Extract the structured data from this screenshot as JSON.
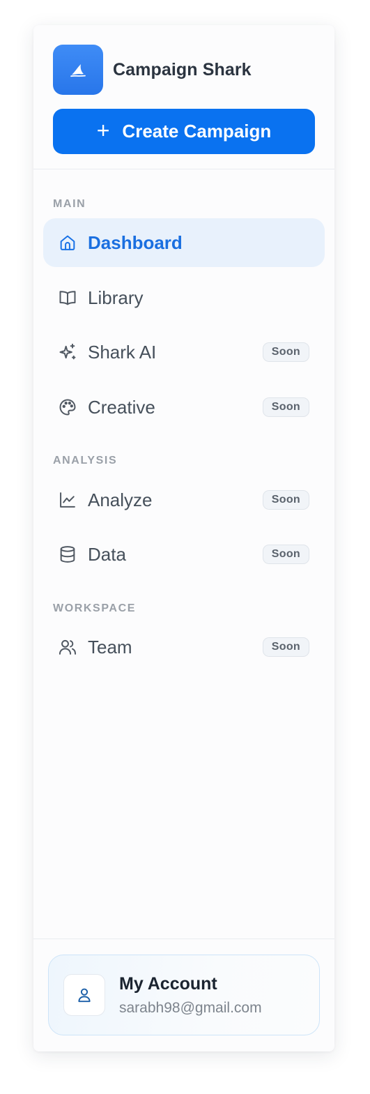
{
  "brand": {
    "name": "Campaign Shark",
    "logo_icon": "shark-fin-icon",
    "logo_color": "#2f7ff0"
  },
  "create_button": {
    "label": "Create Campaign",
    "icon": "plus-icon",
    "color": "#0a72f0"
  },
  "sections": [
    {
      "title": "MAIN"
    },
    {
      "title": "ANALYSIS"
    },
    {
      "title": "WORKSPACE"
    }
  ],
  "nav": {
    "dashboard": {
      "label": "Dashboard",
      "icon": "home-icon",
      "active": true
    },
    "library": {
      "label": "Library",
      "icon": "book-open-icon"
    },
    "shark_ai": {
      "label": "Shark AI",
      "icon": "sparkles-icon",
      "badge": "Soon"
    },
    "creative": {
      "label": "Creative",
      "icon": "palette-icon",
      "badge": "Soon"
    },
    "analyze": {
      "label": "Analyze",
      "icon": "line-chart-icon",
      "badge": "Soon"
    },
    "data": {
      "label": "Data",
      "icon": "database-icon",
      "badge": "Soon"
    },
    "team": {
      "label": "Team",
      "icon": "users-icon",
      "badge": "Soon"
    }
  },
  "account": {
    "name": "My Account",
    "email": "sarabh98@gmail.com",
    "icon": "user-icon"
  },
  "colors": {
    "accent": "#1a6fe0",
    "active_bg": "#e8f1fc",
    "badge_bg": "#f1f4f8"
  }
}
